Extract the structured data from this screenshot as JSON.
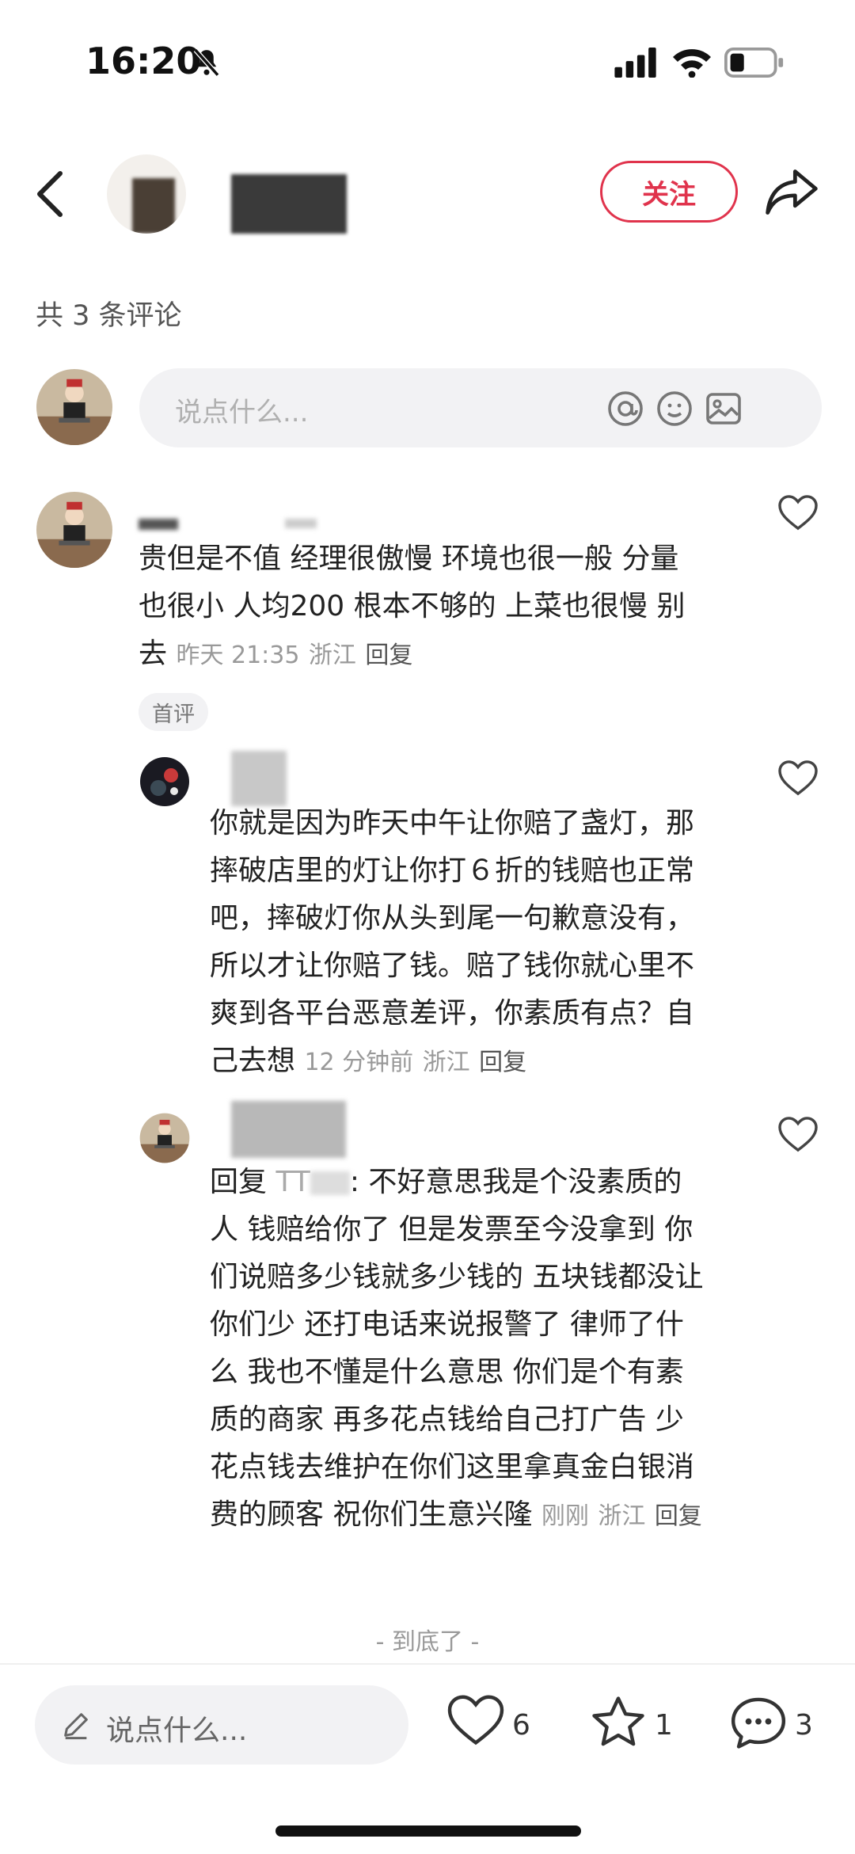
{
  "status_bar": {
    "time": "16:20"
  },
  "header": {
    "follow_label": "关注"
  },
  "comment_count": "共 3 条评论",
  "input": {
    "placeholder": "说点什么..."
  },
  "comments": [
    {
      "text": "贵但是不值 经理很傲慢 环境也很一般 分量也很小 人均200根本不够的 上菜也很慢 别去",
      "line1": "贵但是不值 经理很傲慢 环境也很一般 分量",
      "line2": "也很小 人均200 根本不够的 上菜也很慢 别",
      "line3": "去",
      "time": "昨天 21:35",
      "location": "浙江",
      "reply_label": "回复",
      "tag": "首评"
    },
    {
      "lines": [
        "你就是因为昨天中午让你赔了盏灯，那",
        "摔破店里的灯让你打６折的钱赔也正常",
        "吧，摔破灯你从头到尾一句歉意没有，",
        "所以才让你赔了钱。赔了钱你就心里不",
        "爽到各平台恶意差评，你素质有点？自",
        "己去想"
      ],
      "time": "12 分钟前",
      "location": "浙江",
      "reply_label": "回复"
    },
    {
      "reply_prefix": "回复",
      "reply_to": "TT",
      "lines": [
        ": 不好意思我是个没素质的",
        "人 钱赔给你了 但是发票至今没拿到 你",
        "们说赔多少钱就多少钱的 五块钱都没让",
        "你们少 还打电话来说报警了 律师了什",
        "么 我也不懂是什么意思 你们是个有素",
        "质的商家 再多花点钱给自己打广告 少",
        "花点钱去维护在你们这里拿真金白银消",
        "费的顾客 祝你们生意兴隆"
      ],
      "time": "刚刚",
      "location": "浙江",
      "reply_label": "回复"
    }
  ],
  "end_text": "- 到底了 -",
  "bottom_bar": {
    "placeholder": "说点什么...",
    "likes": "6",
    "stars": "1",
    "comments": "3"
  },
  "colors": {
    "accent": "#e0334c"
  }
}
